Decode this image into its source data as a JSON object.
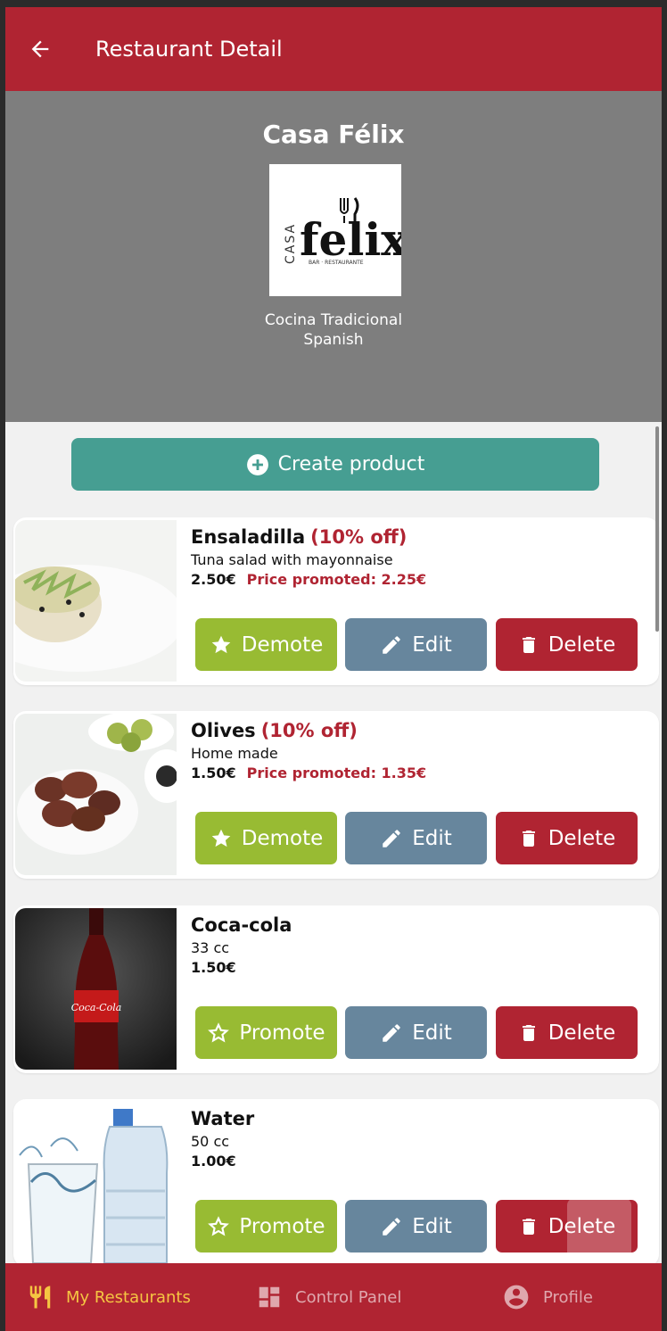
{
  "header": {
    "title": "Restaurant Detail"
  },
  "restaurant": {
    "name": "Casa Félix",
    "logo_text": "CASA félix BAR · RESTAURANTE",
    "cuisine": "Cocina Tradicional",
    "type": "Spanish"
  },
  "actions": {
    "create_product_label": "Create product"
  },
  "products": [
    {
      "name": "Ensaladilla",
      "discount": "(10% off)",
      "description": "Tuna salad with mayonnaise",
      "price": "2.50€",
      "promoted_price": "Price promoted: 2.25€",
      "promote_label": "Demote",
      "edit_label": "Edit",
      "delete_label": "Delete"
    },
    {
      "name": "Olives",
      "discount": "(10% off)",
      "description": "Home made",
      "price": "1.50€",
      "promoted_price": "Price promoted: 1.35€",
      "promote_label": "Demote",
      "edit_label": "Edit",
      "delete_label": "Delete"
    },
    {
      "name": "Coca-cola",
      "discount": "",
      "description": "33 cc",
      "price": "1.50€",
      "promoted_price": "",
      "promote_label": "Promote",
      "edit_label": "Edit",
      "delete_label": "Delete"
    },
    {
      "name": "Water",
      "discount": "",
      "description": "50 cc",
      "price": "1.00€",
      "promoted_price": "",
      "promote_label": "Promote",
      "edit_label": "Edit",
      "delete_label": "Delete"
    }
  ],
  "bottom_nav": [
    {
      "label": "My Restaurants",
      "icon": "restaurant-icon",
      "active": true
    },
    {
      "label": "Control Panel",
      "icon": "dashboard-icon",
      "active": false
    },
    {
      "label": "Profile",
      "icon": "account-circle-icon",
      "active": false
    }
  ],
  "colors": {
    "primary": "#b02432",
    "teal": "#469e92",
    "green": "#98bb33",
    "slate": "#67869d",
    "active_nav": "#f5c542"
  }
}
